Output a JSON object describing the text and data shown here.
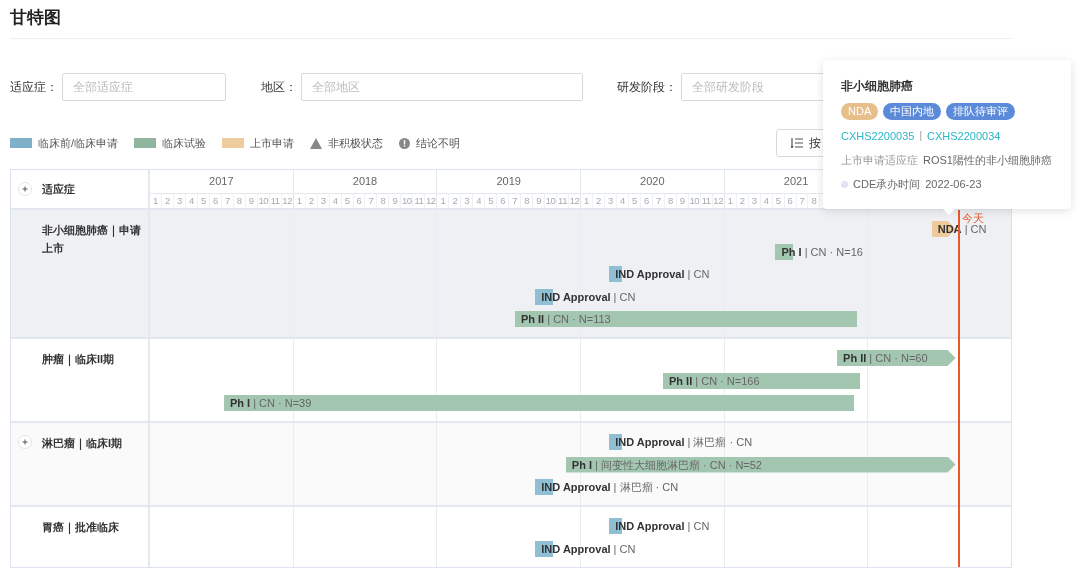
{
  "title": "甘特图",
  "filters": [
    {
      "label": "适应症：",
      "placeholder": "全部适应症"
    },
    {
      "label": "地区：",
      "placeholder": "全部地区"
    },
    {
      "label": "研发阶段：",
      "placeholder": "全部研发阶段"
    }
  ],
  "legend": [
    {
      "kind": "swatch",
      "label": "临床前/临床申请",
      "color": "#7fb0c9"
    },
    {
      "kind": "swatch",
      "label": "临床试验",
      "color": "#8fb59f"
    },
    {
      "kind": "swatch",
      "label": "上市申请",
      "color": "#edcd9e"
    },
    {
      "kind": "triangle",
      "label": "非积极状态"
    },
    {
      "kind": "alert",
      "label": "结论不明"
    }
  ],
  "sort_button": {
    "label": "按"
  },
  "gantt": {
    "header_label": "适应症",
    "years": [
      {
        "label": "2017",
        "months": [
          "1",
          "2",
          "3",
          "4",
          "5",
          "6",
          "7",
          "8",
          "9",
          "10",
          "11",
          "12"
        ]
      },
      {
        "label": "2018",
        "months": [
          "1",
          "2",
          "3",
          "4",
          "5",
          "6",
          "7",
          "8",
          "9",
          "10",
          "11",
          "12"
        ]
      },
      {
        "label": "2019",
        "months": [
          "1",
          "2",
          "3",
          "4",
          "5",
          "6",
          "7",
          "8",
          "9",
          "10",
          "11",
          "12"
        ]
      },
      {
        "label": "2020",
        "months": [
          "1",
          "2",
          "3",
          "4",
          "5",
          "6",
          "7",
          "8",
          "9",
          "10",
          "11",
          "12"
        ]
      },
      {
        "label": "2021",
        "months": [
          "1",
          "2",
          "3",
          "4",
          "5",
          "6",
          "7",
          "8"
        ]
      }
    ],
    "today": {
      "label": "今天"
    },
    "rows": [
      {
        "label": "非小细胞肺癌｜申请上市",
        "expandable": false,
        "selected": true,
        "bars": [
          {
            "kind": "nda",
            "label": "**NDA** | CN",
            "ongoing": true
          },
          {
            "kind": "clinical",
            "label": "**Ph I** | CN · N=16",
            "ongoing": false
          },
          {
            "kind": "preclinical",
            "label": "**IND Approval** | CN",
            "ongoing": false
          },
          {
            "kind": "preclinical",
            "label": "**IND Approval** | CN",
            "ongoing": false
          },
          {
            "kind": "clinical",
            "label": "**Ph II** | CN · N=113",
            "ongoing": false
          }
        ]
      },
      {
        "label": "肿瘤｜临床II期",
        "expandable": false,
        "selected": false,
        "bars": [
          {
            "kind": "clinical",
            "label": "**Ph II** | CN · N=60",
            "ongoing": true
          },
          {
            "kind": "clinical",
            "label": "**Ph II** | CN · N=166",
            "ongoing": false
          },
          {
            "kind": "clinical",
            "label": "**Ph I** | CN · N=39",
            "ongoing": false
          }
        ]
      },
      {
        "label": "淋巴瘤｜临床I期",
        "expandable": true,
        "selected": false,
        "bars": [
          {
            "kind": "preclinical",
            "label": "**IND Approval** | 淋巴瘤 · CN",
            "ongoing": false
          },
          {
            "kind": "clinical",
            "label": "**Ph I** | 间变性大细胞淋巴瘤 · CN · N=52",
            "ongoing": true
          },
          {
            "kind": "preclinical",
            "label": "**IND Approval** | 淋巴瘤 · CN",
            "ongoing": false
          }
        ]
      },
      {
        "label": "胃癌｜批准临床",
        "expandable": false,
        "selected": false,
        "bars": [
          {
            "kind": "preclinical",
            "label": "**IND Approval** | CN",
            "ongoing": false
          },
          {
            "kind": "preclinical",
            "label": "**IND Approval** | CN",
            "ongoing": false
          }
        ]
      }
    ]
  },
  "tooltip": {
    "title": "非小细胞肺癌",
    "tags": [
      {
        "label": "NDA",
        "color": "#e6bf8a"
      },
      {
        "label": "中国内地",
        "color": "#5b8ad8"
      },
      {
        "label": "排队待审评",
        "color": "#5b8ad8"
      }
    ],
    "links": [
      "CXHS2200035",
      "CXHS2200034"
    ],
    "link_separator": "|",
    "fields": [
      {
        "kind": "plain",
        "label": "上市申请适应症",
        "value": "ROS1陽性的非小细胞肺癌"
      },
      {
        "kind": "dated",
        "label": "CDE承办时间",
        "value": "2022-06-23"
      }
    ]
  }
}
